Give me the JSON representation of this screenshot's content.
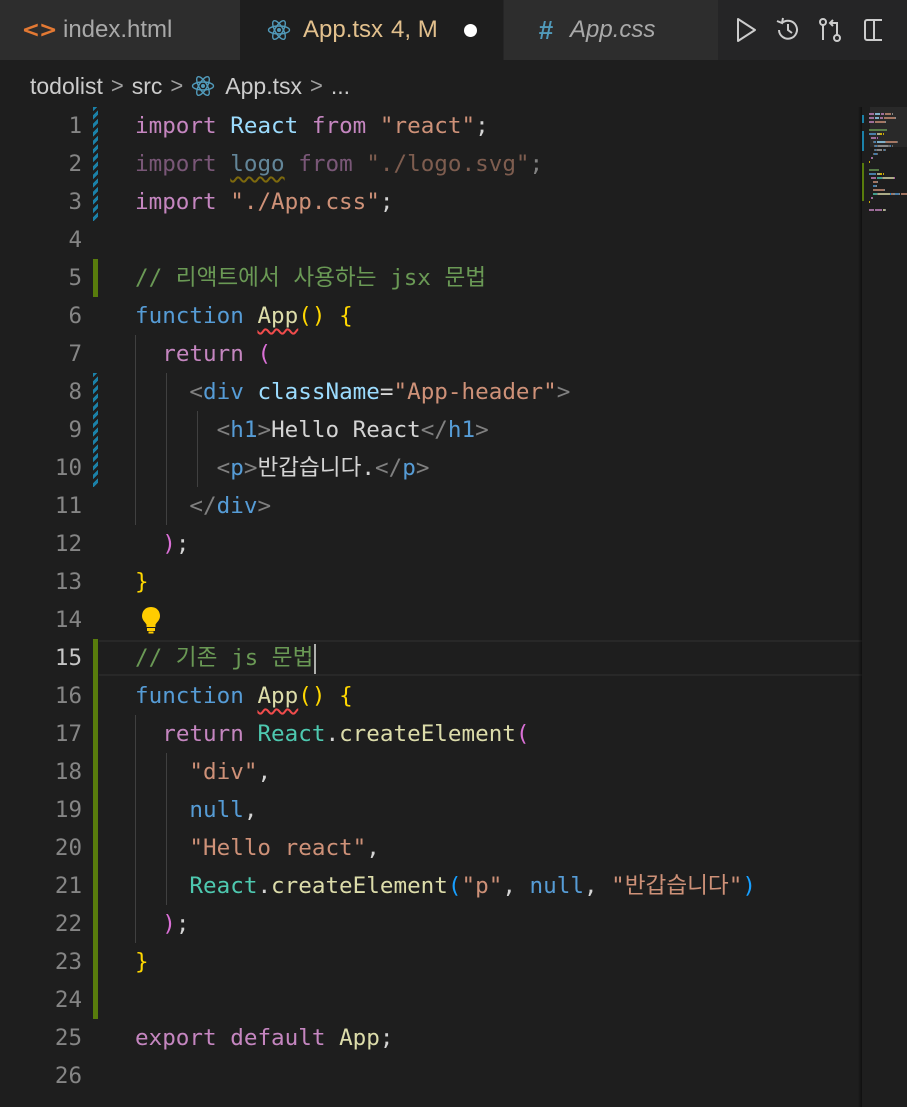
{
  "tabs": [
    {
      "label": "index.html",
      "icon": "html-file-icon"
    },
    {
      "label": "App.tsx",
      "badge": "4, M",
      "icon": "react-icon",
      "dirty": true
    },
    {
      "label": "App.css",
      "icon": "css-hash-icon"
    }
  ],
  "actions": [
    "run-icon",
    "history-icon",
    "compare-changes-icon",
    "split-editor-icon"
  ],
  "breadcrumb": {
    "folder": "todolist",
    "subfolder": "src",
    "file": "App.tsx",
    "more": "..."
  },
  "editor": {
    "current_line": 15,
    "line_numbers": [
      "1",
      "2",
      "3",
      "4",
      "5",
      "6",
      "7",
      "8",
      "9",
      "10",
      "11",
      "12",
      "13",
      "14",
      "15",
      "16",
      "17",
      "18",
      "19",
      "20",
      "21",
      "22",
      "23",
      "24",
      "25",
      "26"
    ],
    "lines": [
      [
        [
          "kw",
          "import"
        ],
        [
          "tx",
          " "
        ],
        [
          "id",
          "React"
        ],
        [
          "tx",
          " "
        ],
        [
          "kw",
          "from"
        ],
        [
          "tx",
          " "
        ],
        [
          "st",
          "\"react\""
        ],
        [
          "tx",
          ";"
        ]
      ],
      [
        [
          "kw dim",
          "import"
        ],
        [
          "tx dim",
          " "
        ],
        [
          "id dim squig-y",
          "logo"
        ],
        [
          "tx dim",
          " "
        ],
        [
          "kw dim",
          "from"
        ],
        [
          "tx dim",
          " "
        ],
        [
          "st dim",
          "\"./logo.svg\""
        ],
        [
          "tx dim",
          ";"
        ]
      ],
      [
        [
          "kw",
          "import"
        ],
        [
          "tx",
          " "
        ],
        [
          "st",
          "\"./App.css\""
        ],
        [
          "tx",
          ";"
        ]
      ],
      [],
      [
        [
          "cm",
          "// 리액트에서 사용하는 jsx 문법"
        ]
      ],
      [
        [
          "sk",
          "function"
        ],
        [
          "tx",
          " "
        ],
        [
          "fn squig",
          "App"
        ],
        [
          "br1",
          "()"
        ],
        [
          "tx",
          " "
        ],
        [
          "br1",
          "{"
        ]
      ],
      [
        [
          "tx",
          "  "
        ],
        [
          "kw",
          "return"
        ],
        [
          "tx",
          " "
        ],
        [
          "br2",
          "("
        ]
      ],
      [
        [
          "tx",
          "    "
        ],
        [
          "pu",
          "<"
        ],
        [
          "tg",
          "div"
        ],
        [
          "tx",
          " "
        ],
        [
          "at",
          "className"
        ],
        [
          "tx",
          "="
        ],
        [
          "st",
          "\"App-header\""
        ],
        [
          "pu",
          ">"
        ]
      ],
      [
        [
          "tx",
          "      "
        ],
        [
          "pu",
          "<"
        ],
        [
          "tg",
          "h1"
        ],
        [
          "pu",
          ">"
        ],
        [
          "tx",
          "Hello React"
        ],
        [
          "pu",
          "</"
        ],
        [
          "tg",
          "h1"
        ],
        [
          "pu",
          ">"
        ]
      ],
      [
        [
          "tx",
          "      "
        ],
        [
          "pu",
          "<"
        ],
        [
          "tg",
          "p"
        ],
        [
          "pu",
          ">"
        ],
        [
          "tx",
          "반갑습니다."
        ],
        [
          "pu",
          "</"
        ],
        [
          "tg",
          "p"
        ],
        [
          "pu",
          ">"
        ]
      ],
      [
        [
          "tx",
          "    "
        ],
        [
          "pu",
          "</"
        ],
        [
          "tg",
          "div"
        ],
        [
          "pu",
          ">"
        ]
      ],
      [
        [
          "tx",
          "  "
        ],
        [
          "br2",
          ")"
        ],
        [
          "tx",
          ";"
        ]
      ],
      [
        [
          "br1",
          "}"
        ]
      ],
      [],
      [
        [
          "cm",
          "// 기존 js 문법"
        ]
      ],
      [
        [
          "sk",
          "function"
        ],
        [
          "tx",
          " "
        ],
        [
          "fn squig",
          "App"
        ],
        [
          "br1",
          "()"
        ],
        [
          "tx",
          " "
        ],
        [
          "br1",
          "{"
        ]
      ],
      [
        [
          "tx",
          "  "
        ],
        [
          "kw",
          "return"
        ],
        [
          "tx",
          " "
        ],
        [
          "ty",
          "React"
        ],
        [
          "tx",
          "."
        ],
        [
          "fn",
          "createElement"
        ],
        [
          "br2",
          "("
        ]
      ],
      [
        [
          "tx",
          "    "
        ],
        [
          "st",
          "\"div\""
        ],
        [
          "tx",
          ","
        ]
      ],
      [
        [
          "tx",
          "    "
        ],
        [
          "sk",
          "null"
        ],
        [
          "tx",
          ","
        ]
      ],
      [
        [
          "tx",
          "    "
        ],
        [
          "st",
          "\"Hello react\""
        ],
        [
          "tx",
          ","
        ]
      ],
      [
        [
          "tx",
          "    "
        ],
        [
          "ty",
          "React"
        ],
        [
          "tx",
          "."
        ],
        [
          "fn",
          "createElement"
        ],
        [
          "br3",
          "("
        ],
        [
          "st",
          "\"p\""
        ],
        [
          "tx",
          ", "
        ],
        [
          "sk",
          "null"
        ],
        [
          "tx",
          ", "
        ],
        [
          "st",
          "\"반갑습니다\""
        ],
        [
          "br3",
          ")"
        ]
      ],
      [
        [
          "tx",
          "  "
        ],
        [
          "br2",
          ")"
        ],
        [
          "tx",
          ";"
        ]
      ],
      [
        [
          "br1",
          "}"
        ]
      ],
      [],
      [
        [
          "kw",
          "export"
        ],
        [
          "tx",
          " "
        ],
        [
          "kw",
          "default"
        ],
        [
          "tx",
          " "
        ],
        [
          "fn",
          "App"
        ],
        [
          "tx",
          ";"
        ]
      ],
      []
    ]
  },
  "colors": {
    "background": "#1e1e1e",
    "tab_bar": "#252526",
    "modified_tab_text": "#e2c08d",
    "gutter_added": "#587c0c",
    "gutter_modified": "#1b81a8",
    "error_squiggle": "#f14c4c",
    "warning_squiggle": "#cca700"
  }
}
